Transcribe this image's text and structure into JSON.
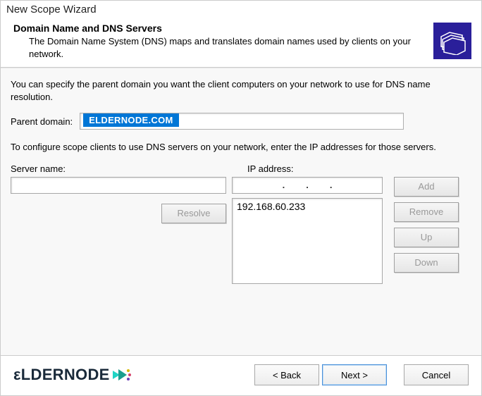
{
  "window": {
    "title": "New Scope Wizard"
  },
  "header": {
    "title": "Domain Name and DNS Servers",
    "description": "The Domain Name System (DNS) maps and translates domain names used by clients on your network."
  },
  "body": {
    "specify_text": "You can specify the parent domain you want the client computers on your network to use for DNS name resolution.",
    "parent_domain_label": "Parent domain:",
    "parent_domain_value": "ELDERNODE.COM",
    "configure_text": "To configure scope clients to use DNS servers on your network, enter the IP addresses for those servers.",
    "server_name_label": "Server name:",
    "ip_address_label": "IP address:",
    "server_name_value": "",
    "ip_entry_value": "",
    "ip_list": [
      "192.168.60.233"
    ],
    "buttons": {
      "resolve": "Resolve",
      "add": "Add",
      "remove": "Remove",
      "up": "Up",
      "down": "Down"
    }
  },
  "footer": {
    "brand": "ELDERNODE",
    "back": "< Back",
    "next": "Next >",
    "cancel": "Cancel"
  }
}
